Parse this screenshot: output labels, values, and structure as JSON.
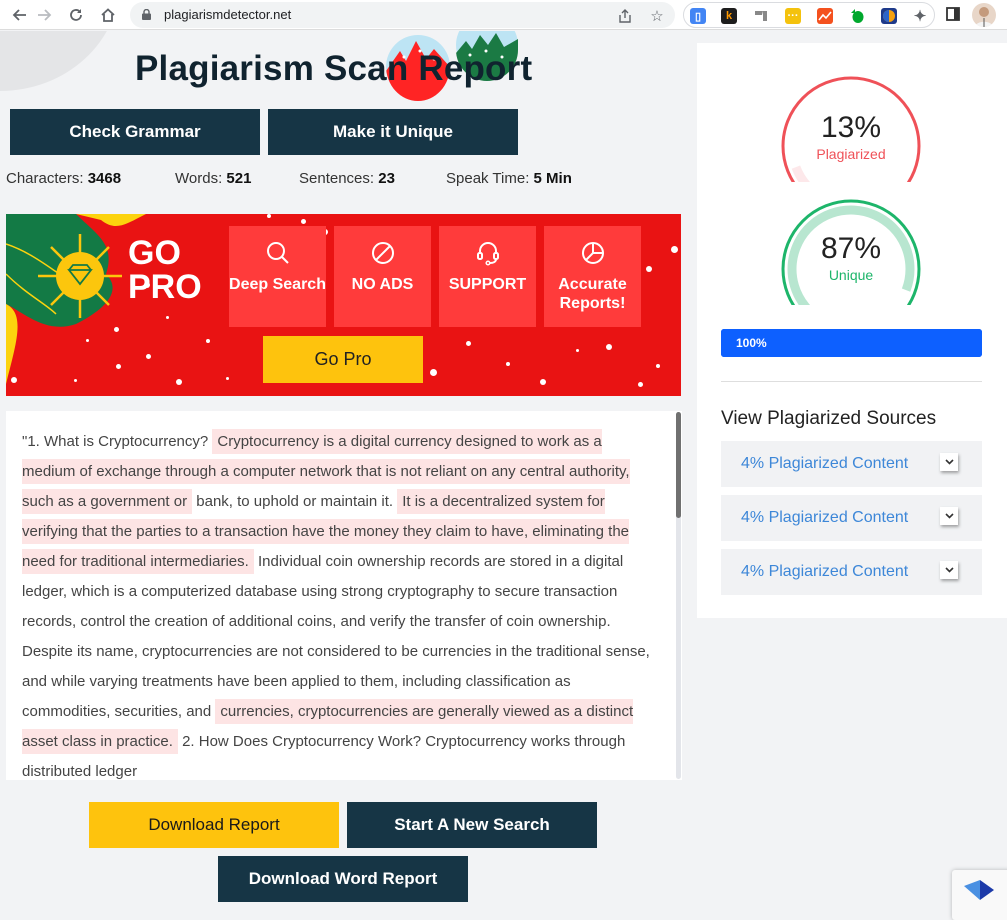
{
  "browser": {
    "url": "plagiarismdetector.net",
    "nav": [
      "back-icon",
      "forward-icon",
      "reload-icon",
      "home-icon"
    ],
    "extensions": [
      {
        "name": "blue-tag-extension",
        "color": "#4285f4"
      },
      {
        "name": "k-extension",
        "glyph": "k",
        "color": "#1d1d1d"
      },
      {
        "name": "gray-extension",
        "color": "#888888"
      },
      {
        "name": "yellow-extension",
        "color": "#f4c20d"
      },
      {
        "name": "analytics-extension",
        "color": "#f4511e"
      },
      {
        "name": "evernote-extension",
        "color": "#00a82d"
      },
      {
        "name": "globe-extension",
        "color": "#1e3a8a"
      }
    ]
  },
  "header": {
    "title": "Plagiarism Scan Report"
  },
  "actions": {
    "check_grammar": "Check Grammar",
    "make_unique": "Make it Unique"
  },
  "stats": [
    {
      "label": "Characters:",
      "value": "3468"
    },
    {
      "label": "Words:",
      "value": "521"
    },
    {
      "label": "Sentences:",
      "value": "23"
    },
    {
      "label": "Speak Time:",
      "value": "5 Min"
    }
  ],
  "banner": {
    "line1": "GO",
    "line2": "PRO",
    "features": [
      {
        "icon": "search-icon",
        "label": "Deep Search"
      },
      {
        "icon": "no-ads-icon",
        "label": "NO ADS"
      },
      {
        "icon": "headset-icon",
        "label": "SUPPORT"
      },
      {
        "icon": "pie-chart-icon",
        "label": "Accurate Reports!"
      }
    ],
    "cta": "Go Pro"
  },
  "text": {
    "segments": [
      {
        "t": "\"1. What is Cryptocurrency? ",
        "hl": false
      },
      {
        "t": "Cryptocurrency is a digital currency designed to work as a medium of exchange through a computer network that is not reliant on any central authority, such as a government or",
        "hl": true
      },
      {
        "t": " bank, to uphold or maintain it. ",
        "hl": false
      },
      {
        "t": "It is a decentralized system for verifying that the parties to a transaction have the money they claim to have, eliminating the need for traditional intermediaries.",
        "hl": true
      },
      {
        "t": " Individual coin ownership records are stored in a digital ledger, which is a computerized database using strong cryptography to secure transaction records, control the creation of additional coins, and verify the transfer of coin ownership. Despite its name, cryptocurrencies are not considered to be currencies in the traditional sense, and while varying treatments have been applied to them, including classification as commodities, securities, and ",
        "hl": false
      },
      {
        "t": "currencies, cryptocurrencies are generally viewed as a distinct asset class in practice.",
        "hl": true
      },
      {
        "t": " 2. How Does Cryptocurrency Work? Cryptocurrency works through distributed ledger",
        "hl": false
      }
    ]
  },
  "results": {
    "plagiarized": {
      "value": "13%",
      "fraction": 0.13,
      "label": "Plagiarized",
      "color": "#ef5158"
    },
    "unique": {
      "value": "87%",
      "fraction": 0.87,
      "label": "Unique",
      "color": "#1db56a"
    },
    "progress": {
      "label": "100%",
      "fraction": 1.0,
      "color": "#0d60ff"
    }
  },
  "sources": {
    "title": "View Plagiarized Sources",
    "items": [
      {
        "label": "4% Plagiarized Content"
      },
      {
        "label": "4% Plagiarized Content"
      },
      {
        "label": "4% Plagiarized Content"
      }
    ]
  },
  "footer": {
    "download_report": "Download Report",
    "new_search": "Start A New Search",
    "download_word": "Download Word Report"
  }
}
